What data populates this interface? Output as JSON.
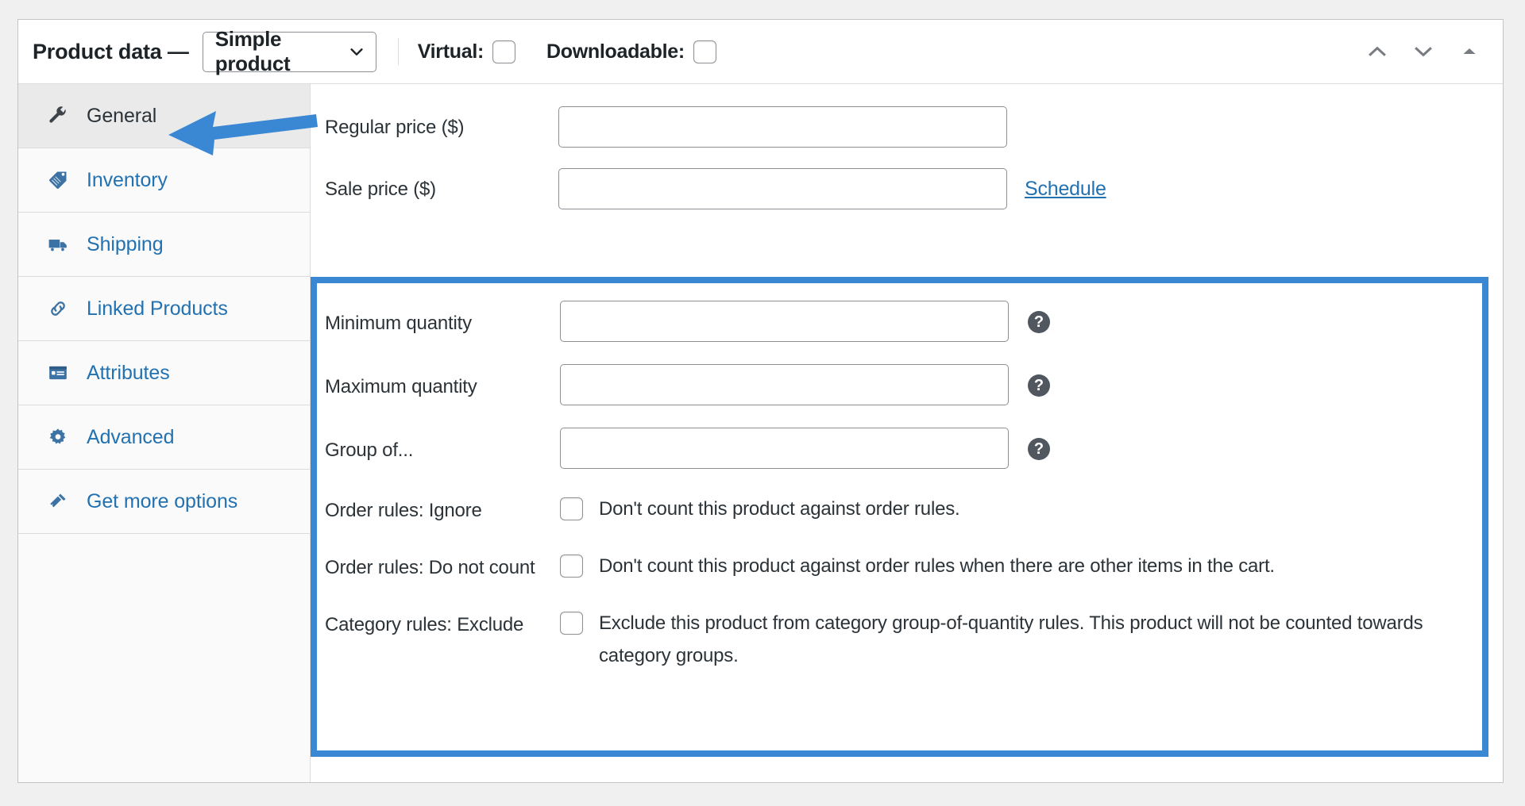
{
  "header": {
    "title": "Product data —",
    "product_type": {
      "selected": "Simple product",
      "chevron_icon": "chevron-down-icon"
    },
    "virtual": {
      "label": "Virtual:",
      "checked": false
    },
    "downloadable": {
      "label": "Downloadable:",
      "checked": false
    },
    "controls": [
      {
        "name": "move-up-icon",
        "glyph": "chevron-up"
      },
      {
        "name": "move-down-icon",
        "glyph": "chevron-down"
      },
      {
        "name": "toggle-panel-icon",
        "glyph": "triangle-up"
      }
    ]
  },
  "tabs": [
    {
      "label": "General",
      "icon": "wrench-icon",
      "active": true
    },
    {
      "label": "Inventory",
      "icon": "tag-icon",
      "active": false
    },
    {
      "label": "Shipping",
      "icon": "truck-icon",
      "active": false
    },
    {
      "label": "Linked Products",
      "icon": "link-icon",
      "active": false
    },
    {
      "label": "Attributes",
      "icon": "list-view-icon",
      "active": false
    },
    {
      "label": "Advanced",
      "icon": "gear-icon",
      "active": false
    },
    {
      "label": "Get more options",
      "icon": "plugin-icon",
      "active": false
    }
  ],
  "pricing": {
    "regular_price": {
      "label": "Regular price ($)",
      "value": "",
      "placeholder": ""
    },
    "sale_price": {
      "label": "Sale price ($)",
      "value": "",
      "placeholder": ""
    },
    "schedule_link": "Schedule"
  },
  "quantity_rules": {
    "minimum_quantity": {
      "label": "Minimum quantity",
      "value": "",
      "help": "?"
    },
    "maximum_quantity": {
      "label": "Maximum quantity",
      "value": "",
      "help": "?"
    },
    "group_of": {
      "label": "Group of...",
      "value": "",
      "help": "?"
    },
    "order_rules_ignore": {
      "label": "Order rules: Ignore",
      "description": "Don't count this product against order rules.",
      "checked": false
    },
    "order_rules_do_not_count": {
      "label": "Order rules: Do not count",
      "description": "Don't count this product against order rules when there are other items in the cart.",
      "checked": false
    },
    "category_rules_exclude": {
      "label": "Category rules: Exclude",
      "description": "Exclude this product from category group-of-quantity rules. This product will not be counted towards category groups.",
      "checked": false
    }
  },
  "annotations": {
    "highlight_color": "#3a87d4",
    "arrow_color": "#3a87d4",
    "arrow_target": "General"
  },
  "colors": {
    "link": "#2271b1",
    "text": "#2c3338",
    "border": "#8c8f94",
    "panel_bg": "#ffffff",
    "page_bg": "#f0f0f1",
    "tab_active_bg": "#eaeaea"
  }
}
